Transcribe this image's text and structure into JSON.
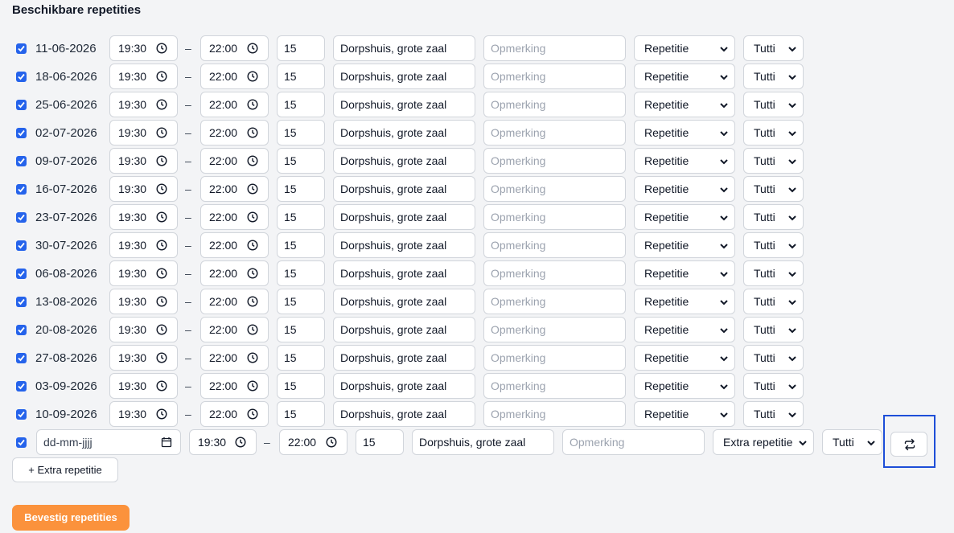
{
  "section_title": "Beschikbare repetities",
  "dash": "–",
  "rows": [
    {
      "checked": true,
      "date": "11-06-2026",
      "start": "19:30",
      "end": "22:00",
      "duration": "15",
      "location": "Dorpshuis, grote zaal",
      "remark_placeholder": "Opmerking",
      "type": "Repetitie",
      "group": "Tutti"
    },
    {
      "checked": true,
      "date": "18-06-2026",
      "start": "19:30",
      "end": "22:00",
      "duration": "15",
      "location": "Dorpshuis, grote zaal",
      "remark_placeholder": "Opmerking",
      "type": "Repetitie",
      "group": "Tutti"
    },
    {
      "checked": true,
      "date": "25-06-2026",
      "start": "19:30",
      "end": "22:00",
      "duration": "15",
      "location": "Dorpshuis, grote zaal",
      "remark_placeholder": "Opmerking",
      "type": "Repetitie",
      "group": "Tutti"
    },
    {
      "checked": true,
      "date": "02-07-2026",
      "start": "19:30",
      "end": "22:00",
      "duration": "15",
      "location": "Dorpshuis, grote zaal",
      "remark_placeholder": "Opmerking",
      "type": "Repetitie",
      "group": "Tutti"
    },
    {
      "checked": true,
      "date": "09-07-2026",
      "start": "19:30",
      "end": "22:00",
      "duration": "15",
      "location": "Dorpshuis, grote zaal",
      "remark_placeholder": "Opmerking",
      "type": "Repetitie",
      "group": "Tutti"
    },
    {
      "checked": true,
      "date": "16-07-2026",
      "start": "19:30",
      "end": "22:00",
      "duration": "15",
      "location": "Dorpshuis, grote zaal",
      "remark_placeholder": "Opmerking",
      "type": "Repetitie",
      "group": "Tutti"
    },
    {
      "checked": true,
      "date": "23-07-2026",
      "start": "19:30",
      "end": "22:00",
      "duration": "15",
      "location": "Dorpshuis, grote zaal",
      "remark_placeholder": "Opmerking",
      "type": "Repetitie",
      "group": "Tutti"
    },
    {
      "checked": true,
      "date": "30-07-2026",
      "start": "19:30",
      "end": "22:00",
      "duration": "15",
      "location": "Dorpshuis, grote zaal",
      "remark_placeholder": "Opmerking",
      "type": "Repetitie",
      "group": "Tutti"
    },
    {
      "checked": true,
      "date": "06-08-2026",
      "start": "19:30",
      "end": "22:00",
      "duration": "15",
      "location": "Dorpshuis, grote zaal",
      "remark_placeholder": "Opmerking",
      "type": "Repetitie",
      "group": "Tutti"
    },
    {
      "checked": true,
      "date": "13-08-2026",
      "start": "19:30",
      "end": "22:00",
      "duration": "15",
      "location": "Dorpshuis, grote zaal",
      "remark_placeholder": "Opmerking",
      "type": "Repetitie",
      "group": "Tutti"
    },
    {
      "checked": true,
      "date": "20-08-2026",
      "start": "19:30",
      "end": "22:00",
      "duration": "15",
      "location": "Dorpshuis, grote zaal",
      "remark_placeholder": "Opmerking",
      "type": "Repetitie",
      "group": "Tutti"
    },
    {
      "checked": true,
      "date": "27-08-2026",
      "start": "19:30",
      "end": "22:00",
      "duration": "15",
      "location": "Dorpshuis, grote zaal",
      "remark_placeholder": "Opmerking",
      "type": "Repetitie",
      "group": "Tutti"
    },
    {
      "checked": true,
      "date": "03-09-2026",
      "start": "19:30",
      "end": "22:00",
      "duration": "15",
      "location": "Dorpshuis, grote zaal",
      "remark_placeholder": "Opmerking",
      "type": "Repetitie",
      "group": "Tutti"
    },
    {
      "checked": true,
      "date": "10-09-2026",
      "start": "19:30",
      "end": "22:00",
      "duration": "15",
      "location": "Dorpshuis, grote zaal",
      "remark_placeholder": "Opmerking",
      "type": "Repetitie",
      "group": "Tutti"
    }
  ],
  "extra_row": {
    "checked": true,
    "date_placeholder": "dd-mm-jjjj",
    "start": "19:30",
    "end": "22:00",
    "duration": "15",
    "location": "Dorpshuis, grote zaal",
    "remark_placeholder": "Opmerking",
    "type": "Extra repetitie",
    "group": "Tutti"
  },
  "add_extra_label": "+ Extra repetitie",
  "confirm_label": "Bevestig repetities",
  "colors": {
    "accent": "#2563eb",
    "confirm": "#fb923c",
    "highlight": "#1d4ed8"
  }
}
